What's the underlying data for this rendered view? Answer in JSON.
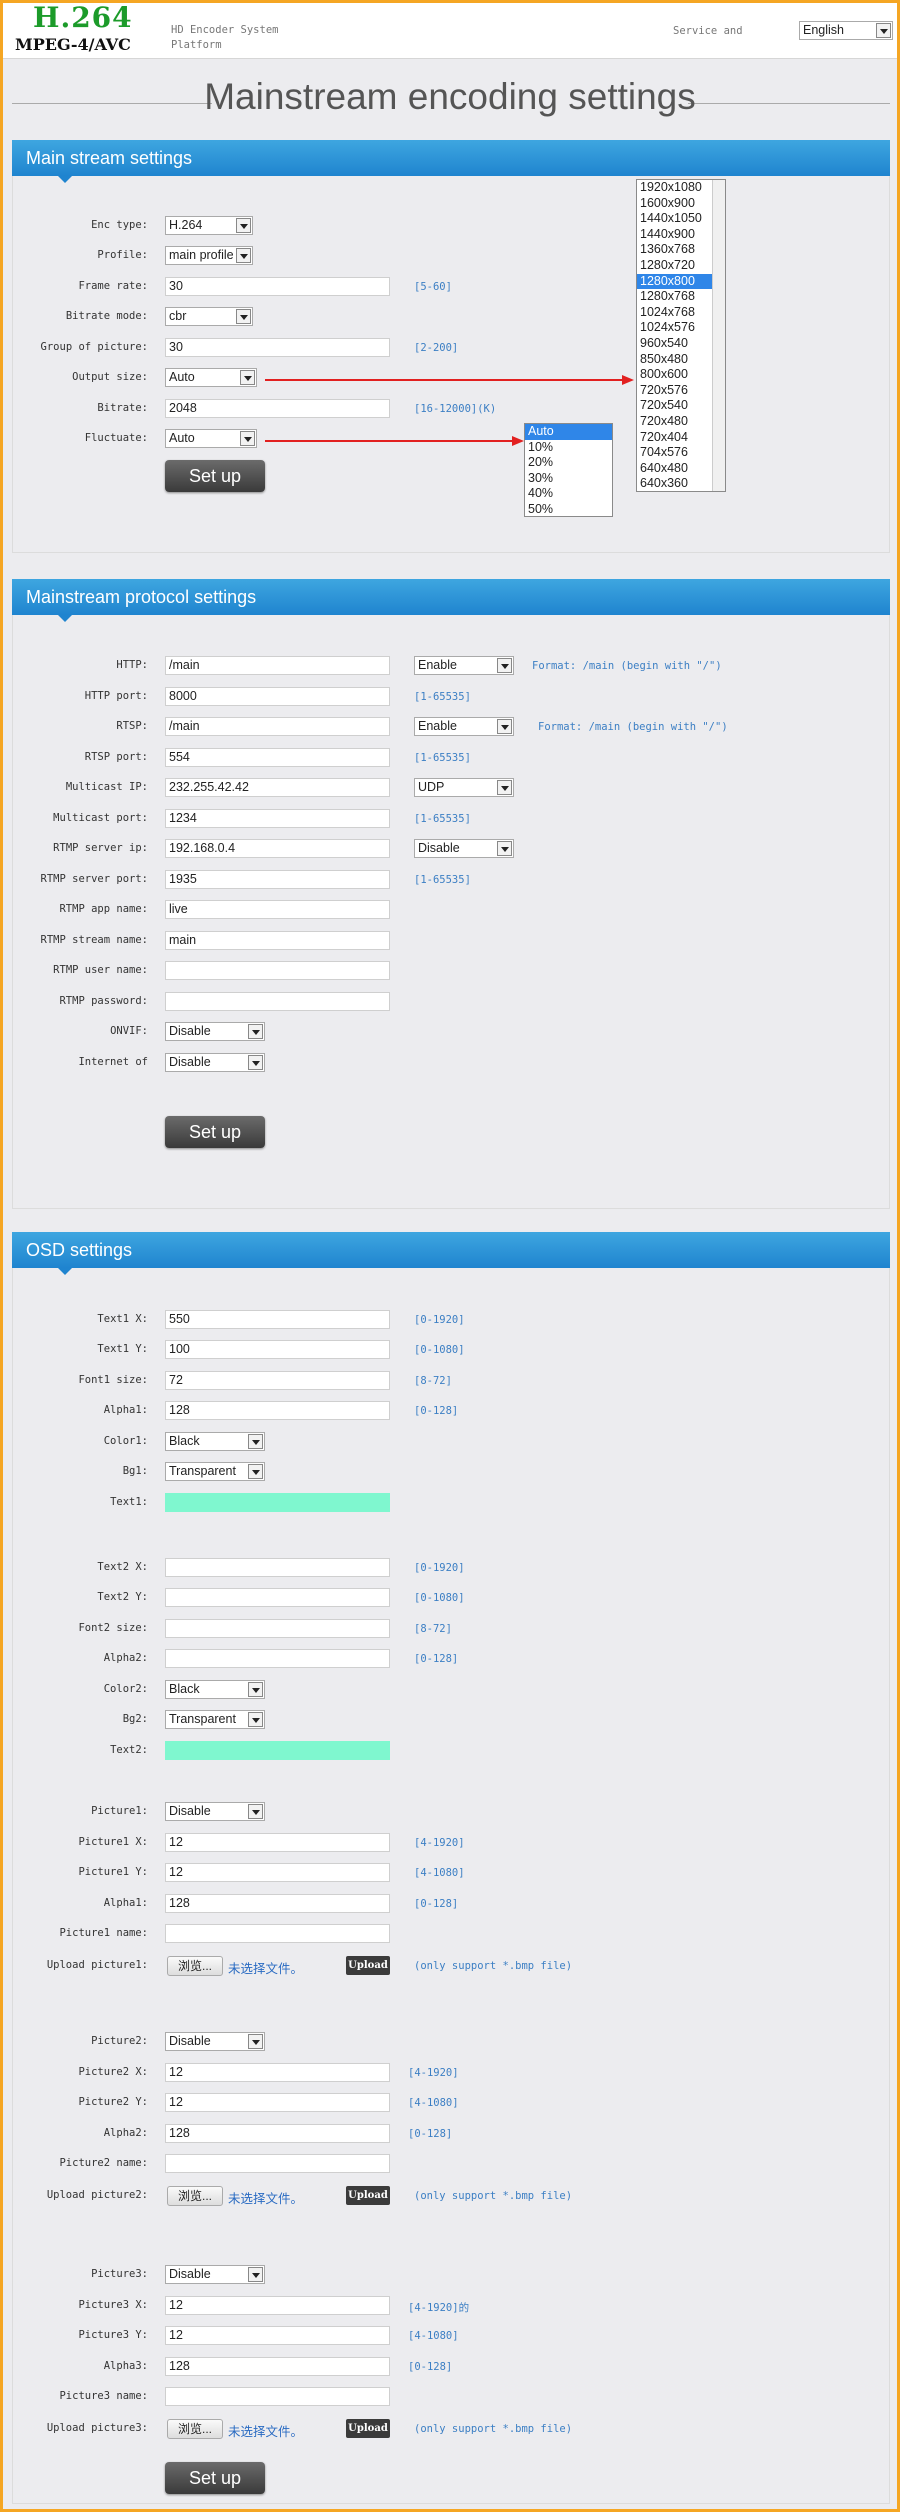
{
  "header": {
    "logo_main": "H.264",
    "logo_sub": "MPEG-4/AVC",
    "platform_text": "HD Encoder System Platform",
    "service_text": "Service and",
    "language": "English"
  },
  "page_title": "Mainstream encoding settings",
  "main_stream": {
    "title": "Main stream settings",
    "enc_type": {
      "label": "Enc type:",
      "value": "H.264"
    },
    "profile": {
      "label": "Profile:",
      "value": "main profile"
    },
    "frame_rate": {
      "label": "Frame rate:",
      "value": "30",
      "hint": "[5-60]"
    },
    "bitrate_mode": {
      "label": "Bitrate mode:",
      "value": "cbr"
    },
    "gop": {
      "label": "Group of picture:",
      "value": "30",
      "hint": "[2-200]"
    },
    "output_size": {
      "label": "Output size:",
      "value": "Auto"
    },
    "bitrate": {
      "label": "Bitrate:",
      "value": "2048",
      "hint": "[16-12000](K)"
    },
    "fluctuate": {
      "label": "Fluctuate:",
      "value": "Auto"
    },
    "setup": "Set up",
    "output_size_options": [
      "1920x1080",
      "1600x900",
      "1440x1050",
      "1440x900",
      "1360x768",
      "1280x720",
      "1280x800",
      "1280x768",
      "1024x768",
      "1024x576",
      "960x540",
      "850x480",
      "800x600",
      "720x576",
      "720x540",
      "720x480",
      "720x404",
      "704x576",
      "640x480",
      "640x360"
    ],
    "output_size_selected": "1280x800",
    "fluctuate_options": [
      "Auto",
      "10%",
      "20%",
      "30%",
      "40%",
      "50%"
    ],
    "fluctuate_selected": "Auto"
  },
  "protocol": {
    "title": "Mainstream protocol settings",
    "http": {
      "label": "HTTP:",
      "value": "/main",
      "enable": "Enable",
      "hint": "Format: /main (begin with \"/\")"
    },
    "http_port": {
      "label": "HTTP port:",
      "value": "8000",
      "hint": "[1-65535]"
    },
    "rtsp": {
      "label": "RTSP:",
      "value": "/main",
      "enable": "Enable",
      "hint": "Format: /main (begin with \"/\")"
    },
    "rtsp_port": {
      "label": "RTSP port:",
      "value": "554",
      "hint": "[1-65535]"
    },
    "multicast_ip": {
      "label": "Multicast IP:",
      "value": "232.255.42.42",
      "proto": "UDP"
    },
    "multicast_port": {
      "label": "Multicast port:",
      "value": "1234",
      "hint": "[1-65535]"
    },
    "rtmp_ip": {
      "label": "RTMP server ip:",
      "value": "192.168.0.4",
      "enable": "Disable"
    },
    "rtmp_port": {
      "label": "RTMP server port:",
      "value": "1935",
      "hint": "[1-65535]"
    },
    "rtmp_app": {
      "label": "RTMP app name:",
      "value": "live"
    },
    "rtmp_stream": {
      "label": "RTMP stream name:",
      "value": "main"
    },
    "rtmp_user": {
      "label": "RTMP user name:",
      "value": ""
    },
    "rtmp_pass": {
      "label": "RTMP password:",
      "value": ""
    },
    "onvif": {
      "label": "ONVIF:",
      "value": "Disable"
    },
    "internet": {
      "label": "Internet of",
      "value": "Disable"
    },
    "setup": "Set up"
  },
  "osd": {
    "title": "OSD settings",
    "text1_x": {
      "label": "Text1 X:",
      "value": "550",
      "hint": "[0-1920]"
    },
    "text1_y": {
      "label": "Text1 Y:",
      "value": "100",
      "hint": "[0-1080]"
    },
    "font1": {
      "label": "Font1 size:",
      "value": "72",
      "hint": "[8-72]"
    },
    "alpha1": {
      "label": "Alpha1:",
      "value": "128",
      "hint": "[0-128]"
    },
    "color1": {
      "label": "Color1:",
      "value": "Black"
    },
    "bg1": {
      "label": "Bg1:",
      "value": "Transparent"
    },
    "text1": {
      "label": "Text1:",
      "value": ""
    },
    "text2_x": {
      "label": "Text2 X:",
      "value": "",
      "hint": "[0-1920]"
    },
    "text2_y": {
      "label": "Text2 Y:",
      "value": "",
      "hint": "[0-1080]"
    },
    "font2": {
      "label": "Font2 size:",
      "value": "",
      "hint": "[8-72]"
    },
    "alpha2": {
      "label": "Alpha2:",
      "value": "",
      "hint": "[0-128]"
    },
    "color2": {
      "label": "Color2:",
      "value": "Black"
    },
    "bg2": {
      "label": "Bg2:",
      "value": "Transparent"
    },
    "text2": {
      "label": "Text2:",
      "value": ""
    },
    "pic1": {
      "label": "Picture1:",
      "value": "Disable"
    },
    "pic1_x": {
      "label": "Picture1 X:",
      "value": "12",
      "hint": "[4-1920]"
    },
    "pic1_y": {
      "label": "Picture1 Y:",
      "value": "12",
      "hint": "[4-1080]"
    },
    "pic1_alpha": {
      "label": "Alpha1:",
      "value": "128",
      "hint": "[0-128]"
    },
    "pic1_name": {
      "label": "Picture1 name:",
      "value": ""
    },
    "pic1_upload": {
      "label": "Upload picture1:",
      "browse": "浏览...",
      "nofile": "未选择文件。",
      "upload": "Upload",
      "hint": "(only support *.bmp file)"
    },
    "pic2": {
      "label": "Picture2:",
      "value": "Disable"
    },
    "pic2_x": {
      "label": "Picture2 X:",
      "value": "12",
      "hint": "[4-1920]"
    },
    "pic2_y": {
      "label": "Picture2 Y:",
      "value": "12",
      "hint": "[4-1080]"
    },
    "pic2_alpha": {
      "label": "Alpha2:",
      "value": "128",
      "hint": "[0-128]"
    },
    "pic2_name": {
      "label": "Picture2 name:",
      "value": ""
    },
    "pic2_upload": {
      "label": "Upload picture2:",
      "browse": "浏览...",
      "nofile": "未选择文件。",
      "upload": "Upload",
      "hint": "(only support *.bmp file)"
    },
    "pic3": {
      "label": "Picture3:",
      "value": "Disable"
    },
    "pic3_x": {
      "label": "Picture3 X:",
      "value": "12",
      "hint": "[4-1920]的"
    },
    "pic3_y": {
      "label": "Picture3 Y:",
      "value": "12",
      "hint": "[4-1080]"
    },
    "pic3_alpha": {
      "label": "Alpha3:",
      "value": "128",
      "hint": "[0-128]"
    },
    "pic3_name": {
      "label": "Picture3 name:",
      "value": ""
    },
    "pic3_upload": {
      "label": "Upload picture3:",
      "browse": "浏览...",
      "nofile": "未选择文件。",
      "upload": "Upload",
      "hint": "(only support *.bmp file)"
    },
    "setup": "Set up"
  }
}
